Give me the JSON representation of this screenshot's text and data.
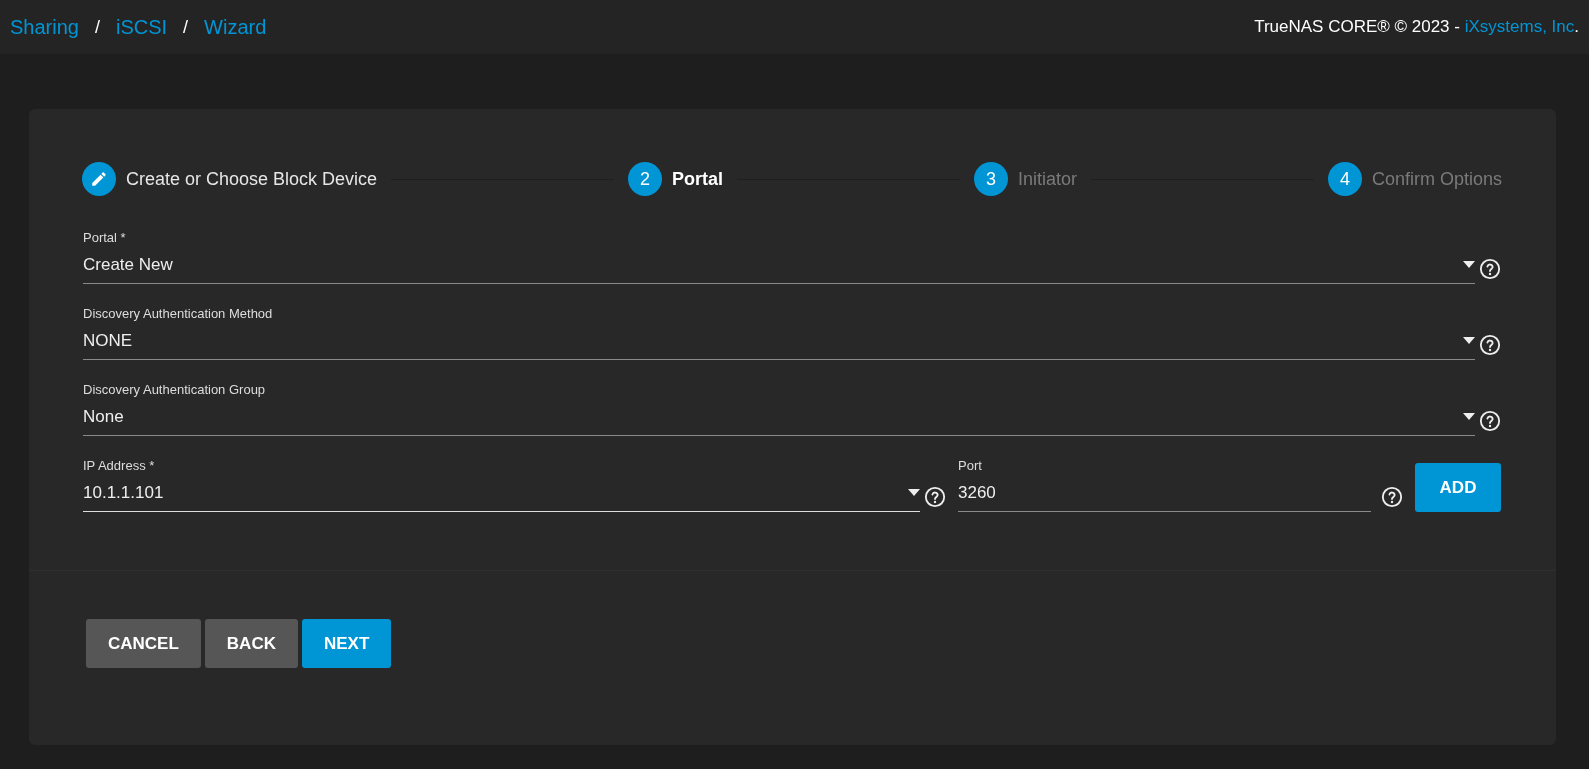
{
  "breadcrumb": [
    {
      "label": "Sharing"
    },
    {
      "label": "iSCSI"
    },
    {
      "label": "Wizard"
    }
  ],
  "breadcrumb_separator": "/",
  "copyright": {
    "text": "TrueNAS CORE® © 2023 - ",
    "link": "iXsystems, Inc",
    "suffix": "."
  },
  "steps": [
    {
      "label": "Create or Choose Block Device",
      "completed": true,
      "selected": false
    },
    {
      "number": "2",
      "label": "Portal",
      "completed": false,
      "selected": true
    },
    {
      "number": "3",
      "label": "Initiator",
      "completed": false,
      "selected": false
    },
    {
      "number": "4",
      "label": "Confirm Options",
      "completed": false,
      "selected": false
    }
  ],
  "fields": [
    {
      "kind": "select",
      "label": "Portal *",
      "value": "Create New"
    },
    {
      "kind": "select",
      "label": "Discovery Authentication Method",
      "value": "NONE"
    },
    {
      "kind": "select",
      "label": "Discovery Authentication Group",
      "value": "None"
    }
  ],
  "ip_row": {
    "ip": {
      "label": "IP Address *",
      "value": "10.1.1.101"
    },
    "port": {
      "label": "Port",
      "value": "3260"
    },
    "add_button": "ADD"
  },
  "buttons": [
    {
      "label": "CANCEL",
      "kind": "secondary"
    },
    {
      "label": "BACK",
      "kind": "secondary"
    },
    {
      "label": "NEXT",
      "kind": "primary"
    }
  ]
}
